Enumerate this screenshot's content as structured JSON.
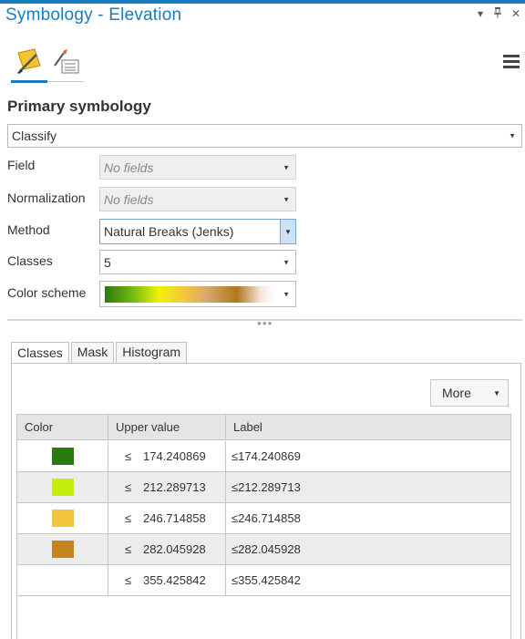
{
  "window": {
    "title": "Symbology - Elevation",
    "controls": [
      "▾",
      "⊟",
      "✕"
    ]
  },
  "tabs_icons": [
    {
      "icon": "paintbrush-icon",
      "active": true
    },
    {
      "icon": "vary-symbology-icon",
      "active": false
    }
  ],
  "primary": {
    "heading": "Primary symbology",
    "renderer": "Classify"
  },
  "form": {
    "field_label": "Field",
    "field_value": "No fields",
    "normalization_label": "Normalization",
    "normalization_value": "No fields",
    "method_label": "Method",
    "method_value": "Natural Breaks (Jenks)",
    "classes_label": "Classes",
    "classes_value": "5",
    "color_scheme_label": "Color scheme"
  },
  "lower_tabs": [
    "Classes",
    "Mask",
    "Histogram"
  ],
  "more_button": "More",
  "grid": {
    "headers": [
      "Color",
      "Upper value",
      "Label"
    ],
    "rows": [
      {
        "color": "#2a7a10",
        "leq": "≤",
        "upper": "174.240869",
        "label": "≤174.240869"
      },
      {
        "color": "#c4ee10",
        "leq": "≤",
        "upper": "212.289713",
        "label": "≤212.289713"
      },
      {
        "color": "#f2c43c",
        "leq": "≤",
        "upper": "246.714858",
        "label": "≤246.714858"
      },
      {
        "color": "#c3861e",
        "leq": "≤",
        "upper": "282.045928",
        "label": "≤282.045928"
      },
      {
        "color": "",
        "leq": "≤",
        "upper": "355.425842",
        "label": "≤355.425842"
      }
    ]
  },
  "colors": {
    "accent": "#1a7bbd"
  }
}
